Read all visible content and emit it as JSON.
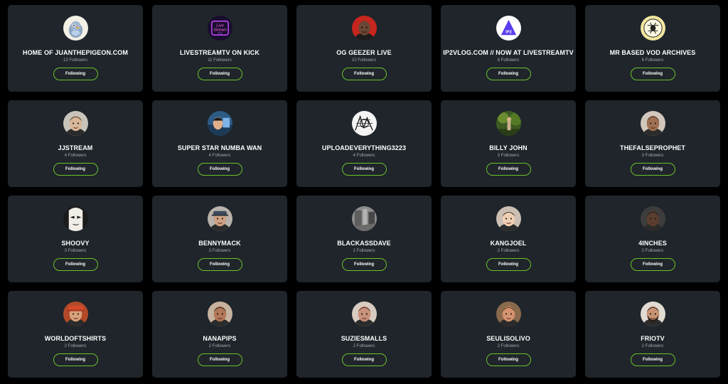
{
  "button_label": "Following",
  "accent_color": "#6cc12a",
  "channels": [
    {
      "name": "HOME OF JUANTHEPIGEON.COM",
      "followers": "13 Followers",
      "avatar": "pigeon"
    },
    {
      "name": "LIVESTREAMTV ON KICK",
      "followers": "11 Followers",
      "avatar": "neon-logo"
    },
    {
      "name": "OG GEEZER LIVE",
      "followers": "10 Followers",
      "avatar": "face-red"
    },
    {
      "name": "IP2VLOG.COM // NOW AT LIVESTREAMTV",
      "followers": "8 Followers",
      "avatar": "triangle-logo"
    },
    {
      "name": "MR BASED VOD ARCHIVES",
      "followers": "6 Followers",
      "avatar": "emblem"
    },
    {
      "name": "JJSTREAM",
      "followers": "4 Followers",
      "avatar": "face-light"
    },
    {
      "name": "SUPER STAR NUMBA WAN",
      "followers": "4 Followers",
      "avatar": "face-blue"
    },
    {
      "name": "UPLOADEVERYTHING3223",
      "followers": "4 Followers",
      "avatar": "sketch"
    },
    {
      "name": "BILLY JOHN",
      "followers": "3 Followers",
      "avatar": "green-scene"
    },
    {
      "name": "THEFALSEPROPHET",
      "followers": "3 Followers",
      "avatar": "face-brown"
    },
    {
      "name": "SHOOVY",
      "followers": "3 Followers",
      "avatar": "mask"
    },
    {
      "name": "BENNYMACK",
      "followers": "3 Followers",
      "avatar": "face-cap"
    },
    {
      "name": "BLACKASSDAVE",
      "followers": "2 Followers",
      "avatar": "gray-photo"
    },
    {
      "name": "KANGJOEL",
      "followers": "2 Followers",
      "avatar": "face-pale"
    },
    {
      "name": "4INCHES",
      "followers": "2 Followers",
      "avatar": "face-dark"
    },
    {
      "name": "WORLDOFTSHIRTS",
      "followers": "2 Followers",
      "avatar": "face-hat"
    },
    {
      "name": "NANAPIPS",
      "followers": "2 Followers",
      "avatar": "face-smile"
    },
    {
      "name": "SUZIESMALLS",
      "followers": "2 Followers",
      "avatar": "face-soft"
    },
    {
      "name": "SEULISOLIVO",
      "followers": "2 Followers",
      "avatar": "face-warm"
    },
    {
      "name": "FRIOTV",
      "followers": "2 Followers",
      "avatar": "face-beard"
    }
  ]
}
